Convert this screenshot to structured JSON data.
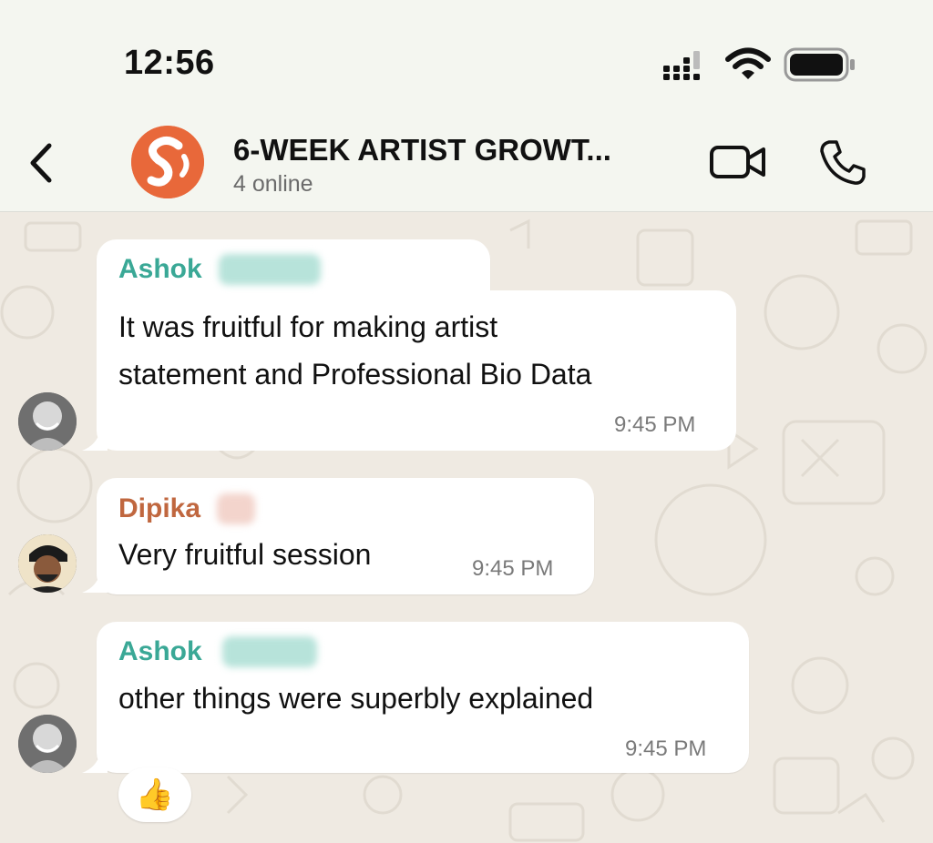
{
  "status_bar": {
    "time": "12:56"
  },
  "header": {
    "back_icon": "chevron-left-icon",
    "title": "6-WEEK ARTIST GROWT...",
    "subtitle": "4 online",
    "video_icon": "video-camera-icon",
    "call_icon": "phone-icon",
    "group_avatar_color": "#e8683a"
  },
  "messages": [
    {
      "sender": "Ashok",
      "sender_color": "#3aa896",
      "lines": [
        "It was fruitful for making artist",
        "statement and Professional Bio Data"
      ],
      "time": "9:45 PM"
    },
    {
      "sender": "Dipika",
      "sender_color": "#c0673f",
      "lines": [
        "Very fruitful session"
      ],
      "time": "9:45 PM"
    },
    {
      "sender": "Ashok",
      "sender_color": "#3aa896",
      "lines": [
        "other things were superbly explained"
      ],
      "time": "9:45 PM",
      "reaction": "👍"
    }
  ],
  "colors": {
    "chat_bg": "#efeae2",
    "bubble": "#ffffff",
    "header_bg": "#f4f6f0"
  }
}
